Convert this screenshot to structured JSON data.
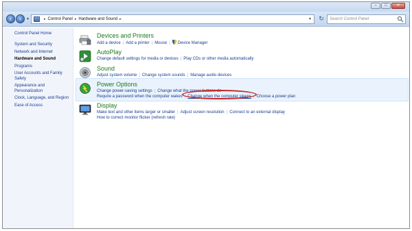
{
  "window": {
    "controls": [
      "–",
      "□",
      "✕"
    ]
  },
  "navbar": {
    "breadcrumb": [
      "Control Panel",
      "Hardware and Sound"
    ],
    "search_placeholder": "Search Control Panel"
  },
  "leftnav": {
    "home": "Control Panel Home",
    "items": [
      "System and Security",
      "Network and Internet",
      "Hardware and Sound",
      "Programs",
      "User Accounts and Family Safety",
      "Appearance and Personalization",
      "Clock, Language, and Region",
      "Ease of Access"
    ],
    "current_index": 2
  },
  "categories": {
    "devices": {
      "title": "Devices and Printers",
      "links": [
        "Add a device",
        "Add a printer",
        "Mouse",
        "Device Manager"
      ]
    },
    "autoplay": {
      "title": "AutoPlay",
      "links": [
        "Change default settings for media or devices",
        "Play CDs or other media automatically"
      ]
    },
    "sound": {
      "title": "Sound",
      "links": [
        "Adjust system volume",
        "Change system sounds",
        "Manage audio devices"
      ]
    },
    "power": {
      "title": "Power Options",
      "links_row1": [
        "Change power-saving settings",
        "Change what the power buttons do"
      ],
      "links_row2": [
        "Require a password when the computer wakes",
        "Change when the computer sleeps",
        "Choose a power plan"
      ]
    },
    "display": {
      "title": "Display",
      "links_row1": [
        "Make text and other items larger or smaller",
        "Adjust screen resolution",
        "Connect to an external display"
      ],
      "links_row2": [
        "How to correct monitor flicker (refresh rate)"
      ]
    }
  },
  "colors": {
    "category_title": "#1a7a1a",
    "link": "#1a3a8f",
    "highlight_oval": "#c22a2a"
  }
}
